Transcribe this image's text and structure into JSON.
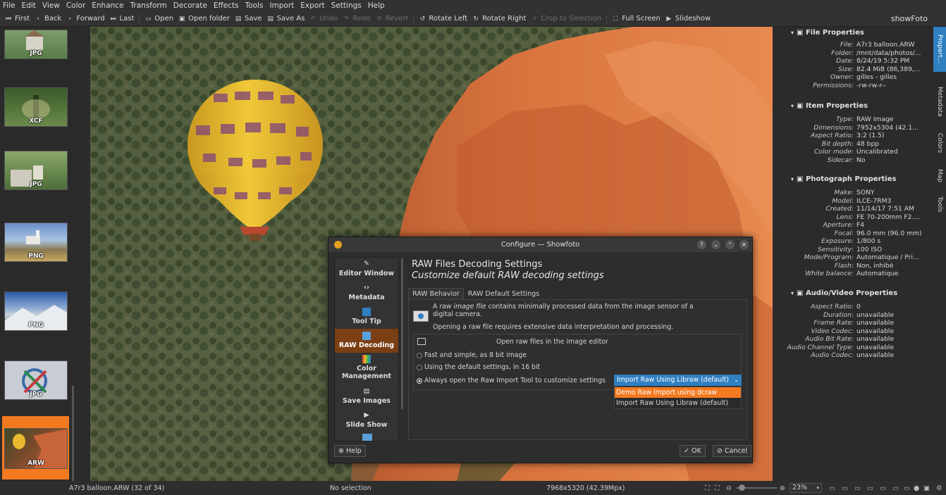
{
  "menu": [
    "File",
    "Edit",
    "View",
    "Color",
    "Enhance",
    "Transform",
    "Decorate",
    "Effects",
    "Tools",
    "Import",
    "Export",
    "Settings",
    "Help"
  ],
  "toolbar": {
    "first": "First",
    "back": "Back",
    "forward": "Forward",
    "last": "Last",
    "open": "Open",
    "open_folder": "Open folder",
    "save": "Save",
    "save_as": "Save As",
    "undo": "Undo",
    "redo": "Redo",
    "revert": "Revert",
    "rotate_left": "Rotate Left",
    "rotate_right": "Rotate Right",
    "crop": "Crop to Selection",
    "full_screen": "Full Screen",
    "slideshow": "Slideshow"
  },
  "app_name": "showFoto",
  "thumbnails": [
    "JPG",
    "XCF",
    "JPG",
    "PNG",
    "PNG",
    "JPG",
    "ARW"
  ],
  "file_properties": {
    "title": "File Properties",
    "rows": [
      {
        "k": "File:",
        "v": "A7r3 balloon.ARW"
      },
      {
        "k": "Folder:",
        "v": "/mnt/data/photos/..."
      },
      {
        "k": "Date:",
        "v": "8/24/19 5:32 PM"
      },
      {
        "k": "Size:",
        "v": "82.4 MiB (86,389,..."
      },
      {
        "k": "Owner:",
        "v": "gilles - gilles"
      },
      {
        "k": "Permissions:",
        "v": "-rw-rw-r--"
      }
    ]
  },
  "item_properties": {
    "title": "Item Properties",
    "rows": [
      {
        "k": "Type:",
        "v": "RAW Image"
      },
      {
        "k": "Dimensions:",
        "v": "7952x5304 (42.1..."
      },
      {
        "k": "Aspect Ratio:",
        "v": "3:2 (1.5)"
      },
      {
        "k": "Bit depth:",
        "v": "48 bpp"
      },
      {
        "k": "Color mode:",
        "v": "Uncalibrated"
      },
      {
        "k": "Sidecar:",
        "v": "No"
      }
    ]
  },
  "photo_properties": {
    "title": "Photograph Properties",
    "rows": [
      {
        "k": "Make:",
        "v": "SONY"
      },
      {
        "k": "Model:",
        "v": "ILCE-7RM3"
      },
      {
        "k": "Created:",
        "v": "11/14/17 7:51 AM"
      },
      {
        "k": "Lens:",
        "v": "FE 70-200mm F2...."
      },
      {
        "k": "Aperture:",
        "v": "F4"
      },
      {
        "k": "Focal:",
        "v": "96.0 mm (96.0 mm)"
      },
      {
        "k": "Exposure:",
        "v": "1/800 s"
      },
      {
        "k": "Sensitivity:",
        "v": "100 ISO"
      },
      {
        "k": "Mode/Program:",
        "v": "Automatique / Pri..."
      },
      {
        "k": "Flash:",
        "v": "Non, inhibé"
      },
      {
        "k": "White balance:",
        "v": "Automatique"
      }
    ]
  },
  "av_properties": {
    "title": "Audio/Video Properties",
    "rows": [
      {
        "k": "Aspect Ratio:",
        "v": "0"
      },
      {
        "k": "Duration:",
        "v": "unavailable"
      },
      {
        "k": "Frame Rate:",
        "v": "unavailable"
      },
      {
        "k": "Video Codec:",
        "v": "unavailable"
      },
      {
        "k": "Audio Bit Rate:",
        "v": "unavailable"
      },
      {
        "k": "Audio Channel Type:",
        "v": "unavailable"
      },
      {
        "k": "Audio Codec:",
        "v": "unavailable"
      }
    ]
  },
  "side_tabs": [
    "Propert...",
    "Metadata",
    "Colors",
    "Map",
    "Tools"
  ],
  "status": {
    "file": "A7r3 balloon.ARW (32 of 34)",
    "selection": "No selection",
    "dims": "7968x5320 (42.39Mpx)",
    "zoom": "23%"
  },
  "dialog": {
    "title": "Configure — Showfoto",
    "sections": [
      "Editor Window",
      "Metadata",
      "Tool Tip",
      "RAW Decoding",
      "Color Management",
      "Save Images",
      "Slide Show"
    ],
    "heading": "RAW Files Decoding Settings",
    "subheading": "Customize default RAW decoding settings",
    "tabs": [
      "RAW Behavior",
      "RAW Default Settings"
    ],
    "info1a": "A",
    "info1b": "raw image file",
    "info1c": "contains minimally processed data from the image sensor of a",
    "info2": "digital camera.",
    "info3": "Opening a raw file requires extensive data interpretation and processing.",
    "group_title": "Open raw files in the image editor",
    "opt1": "Fast and simple, as 8 bit image",
    "opt2": "Using the default settings, in 16 bit",
    "opt3": "Always open the Raw Import Tool to customize settings",
    "combo_value": "Import Raw Using Libraw (default)",
    "combo_options": [
      "Demo Raw Import using dcraw",
      "Import Raw Using Libraw (default)"
    ],
    "help": "Help",
    "ok": "OK",
    "cancel": "Cancel"
  }
}
